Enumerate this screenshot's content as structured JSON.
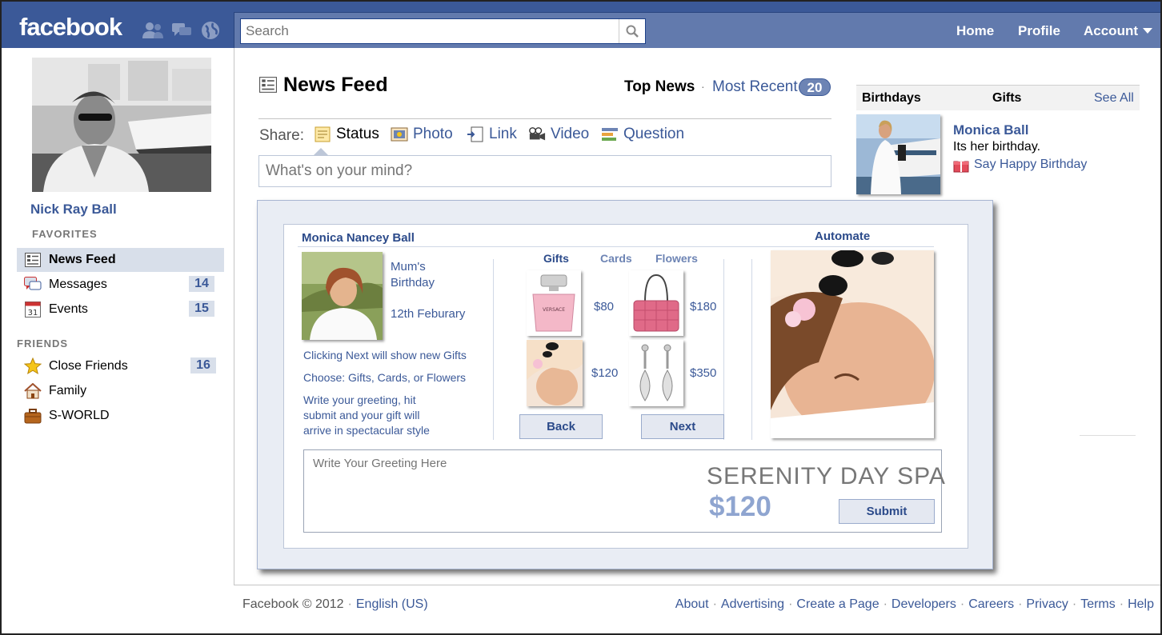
{
  "header": {
    "logo": "facebook",
    "search_placeholder": "Search",
    "nav": {
      "home": "Home",
      "profile": "Profile",
      "account": "Account"
    }
  },
  "sidebar": {
    "name": "Nick Ray Ball",
    "favorites_heading": "FAVORITES",
    "favorites": [
      {
        "label": "News Feed",
        "count": ""
      },
      {
        "label": "Messages",
        "count": "14"
      },
      {
        "label": "Events",
        "count": "15"
      }
    ],
    "friends_heading": "FRIENDS",
    "friends": [
      {
        "label": "Close Friends",
        "count": "16"
      },
      {
        "label": "Family",
        "count": ""
      },
      {
        "label": "S-WORLD",
        "count": ""
      }
    ]
  },
  "feed": {
    "title": "News Feed",
    "top_news": "Top News",
    "most_recent": "Most Recent",
    "recent_count": "20",
    "share_label": "Share:",
    "share_options": [
      "Status",
      "Photo",
      "Link",
      "Video",
      "Question"
    ],
    "status_placeholder": "What's on your mind?"
  },
  "gift_app": {
    "recipient": "Monica Nancey Ball",
    "automate": "Automate",
    "occasion_line1": "Mum's",
    "occasion_line2": "Birthday",
    "date": "12th Feburary",
    "hint_next": "Clicking Next will show new Gifts",
    "hint_choose": "Choose: Gifts, Cards, or Flowers",
    "hint_write_1": "Write your greeting, hit",
    "hint_write_2": "submit and your gift will",
    "hint_write_3": "arrive in spectacular style",
    "tabs": [
      "Gifts",
      "Cards",
      "Flowers"
    ],
    "items": [
      {
        "name": "perfume",
        "price": "$80"
      },
      {
        "name": "handbag",
        "price": "$180"
      },
      {
        "name": "spa",
        "price": "$120"
      },
      {
        "name": "earrings",
        "price": "$350"
      }
    ],
    "back": "Back",
    "next": "Next",
    "greeting_placeholder": "Write Your Greeting Here",
    "selected_name": "SERENITY DAY SPA",
    "selected_price": "$120",
    "submit": "Submit",
    "perfume_brand": "VERSACE"
  },
  "birthdays": {
    "tab_birthdays": "Birthdays",
    "tab_gifts": "Gifts",
    "see_all": "See All",
    "name": "Monica Ball",
    "text": "Its her birthday.",
    "link": "Say Happy Birthday"
  },
  "footer": {
    "copyright": "Facebook © 2012",
    "language": "English (US)",
    "links": [
      "About",
      "Advertising",
      "Create a Page",
      "Developers",
      "Careers",
      "Privacy",
      "Terms",
      "Help"
    ]
  },
  "colors": {
    "brand": "#3b5998",
    "brand_light": "#627aad",
    "highlight": "#d8dfea"
  }
}
